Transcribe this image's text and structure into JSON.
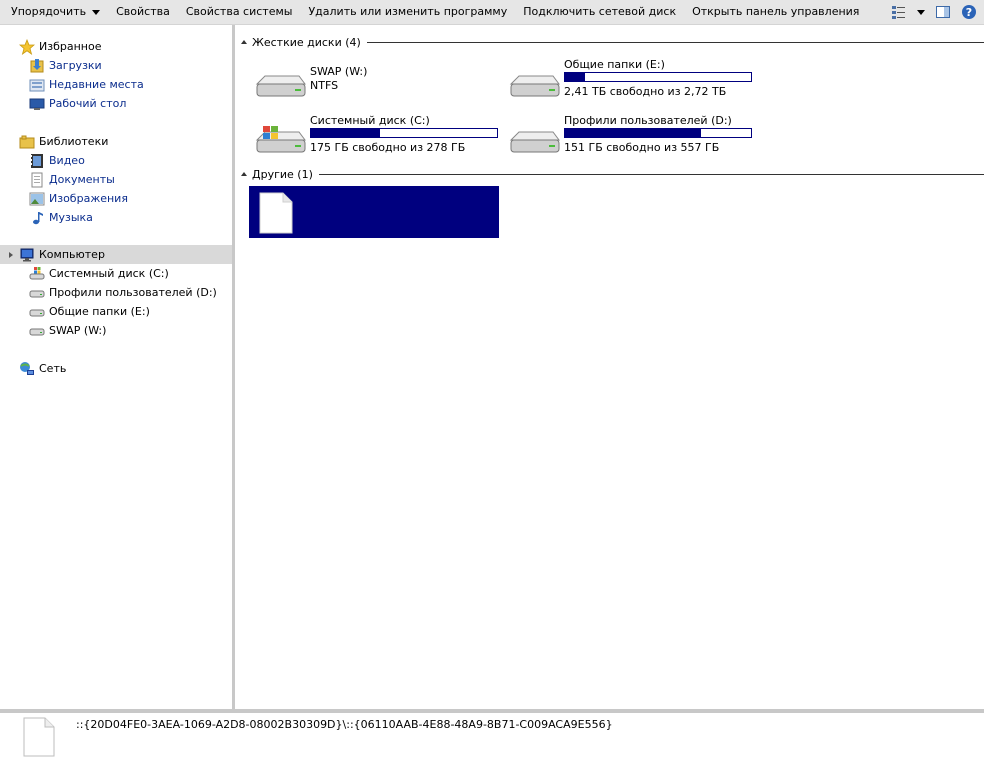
{
  "toolbar": {
    "organize": "Упорядочить",
    "properties": "Свойства",
    "system_properties": "Свойства системы",
    "uninstall": "Удалить или изменить программу",
    "map_drive": "Подключить сетевой диск",
    "control_panel": "Открыть панель управления",
    "icons": [
      "view-options-icon",
      "chevron-down-icon",
      "preview-pane-icon",
      "help-icon"
    ]
  },
  "nav": {
    "favorites": {
      "label": "Избранное",
      "icon": "star-icon",
      "items": [
        {
          "label": "Загрузки",
          "icon": "downloads-folder-icon"
        },
        {
          "label": "Недавние места",
          "icon": "recent-places-icon"
        },
        {
          "label": "Рабочий стол",
          "icon": "desktop-icon"
        }
      ]
    },
    "libraries": {
      "label": "Библиотеки",
      "icon": "libraries-icon",
      "items": [
        {
          "label": "Видео",
          "icon": "video-icon"
        },
        {
          "label": "Документы",
          "icon": "documents-icon"
        },
        {
          "label": "Изображения",
          "icon": "pictures-icon"
        },
        {
          "label": "Музыка",
          "icon": "music-icon"
        }
      ]
    },
    "computer": {
      "label": "Компьютер",
      "icon": "computer-icon",
      "items": [
        {
          "label": "Системный диск (C:)",
          "icon": "system-drive-icon"
        },
        {
          "label": "Профили пользователей (D:)",
          "icon": "drive-icon"
        },
        {
          "label": "Общие папки (E:)",
          "icon": "drive-icon"
        },
        {
          "label": "SWAP (W:)",
          "icon": "drive-icon"
        }
      ]
    },
    "network": {
      "label": "Сеть",
      "icon": "network-icon"
    }
  },
  "content": {
    "hard_drives_header": "Жесткие диски (4)",
    "drives": [
      {
        "name": "SWAP (W:)",
        "info": "NTFS",
        "has_bar": false,
        "used_fraction": null
      },
      {
        "name": "Общие папки (E:)",
        "info": "2,41 ТБ свободно из 2,72 ТБ",
        "has_bar": true,
        "used_fraction": 0.11
      },
      {
        "name": "Системный диск (C:)",
        "info": "175 ГБ свободно из 278 ГБ",
        "has_bar": true,
        "used_fraction": 0.37
      },
      {
        "name": "Профили пользователей (D:)",
        "info": "151 ГБ свободно из 557 ГБ",
        "has_bar": true,
        "used_fraction": 0.73
      }
    ],
    "other_header": "Другие (1)"
  },
  "details": {
    "path": "::{20D04FE0-3AEA-1069-A2D8-08002B30309D}\\::{06110AAB-4E88-48A9-8B71-C009ACA9E556}"
  },
  "colors": {
    "selection": "#00007f",
    "toolbar_bg": "#e6e6e6",
    "nav_selected": "#d9d9d9"
  }
}
